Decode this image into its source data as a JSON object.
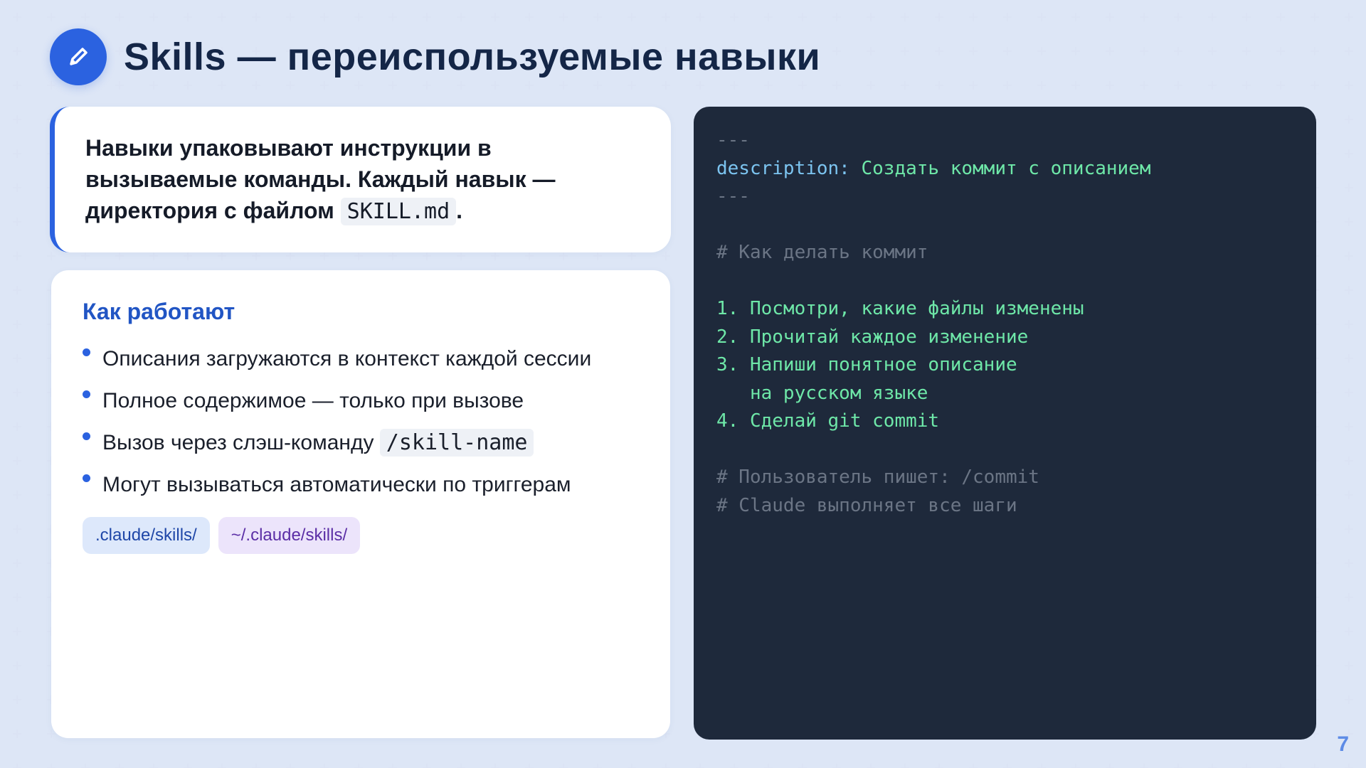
{
  "header": {
    "title": "Skills — переиспользуемые навыки",
    "icon": "pencil-icon",
    "accent_color": "#2b62e0"
  },
  "intro": {
    "text_before": "Навыки упаковывают инструкции в вызываемые команды. Каждый навык — директория с файлом ",
    "code": "SKILL.md",
    "text_after": "."
  },
  "how_it_works": {
    "title": "Как работают",
    "items": [
      {
        "text": "Описания загружаются в контекст каждой сессии",
        "code": ""
      },
      {
        "text": "Полное содержимое — только при вызове",
        "code": ""
      },
      {
        "text": "Вызов через слэш-команду ",
        "code": "/skill-name"
      },
      {
        "text": "Могут вызываться автоматически по триггерам",
        "code": ""
      }
    ],
    "tags": [
      ".claude/skills/",
      "~/.claude/skills/"
    ]
  },
  "code_panel": {
    "lines": [
      {
        "text": "---",
        "color": "gray"
      },
      {
        "text": "description:",
        "text2": " Создать коммит с описанием",
        "color": "blue",
        "color2": "green"
      },
      {
        "text": "---",
        "color": "gray"
      },
      {
        "text": "",
        "color": "gray"
      },
      {
        "text": "# Как делать коммит",
        "color": "gray"
      },
      {
        "text": "",
        "color": "gray"
      },
      {
        "text": "1. Посмотри, какие файлы изменены",
        "color": "green"
      },
      {
        "text": "2. Прочитай каждое изменение",
        "color": "green"
      },
      {
        "text": "3. Напиши понятное описание",
        "color": "green"
      },
      {
        "text": "   на русском языке",
        "color": "green"
      },
      {
        "text": "4. Сделай git commit",
        "color": "green"
      },
      {
        "text": "",
        "color": "gray"
      },
      {
        "text": "# Пользователь пишет: /commit",
        "color": "gray"
      },
      {
        "text": "# Claude выполняет все шаги",
        "color": "gray"
      }
    ]
  },
  "page_number": "7"
}
